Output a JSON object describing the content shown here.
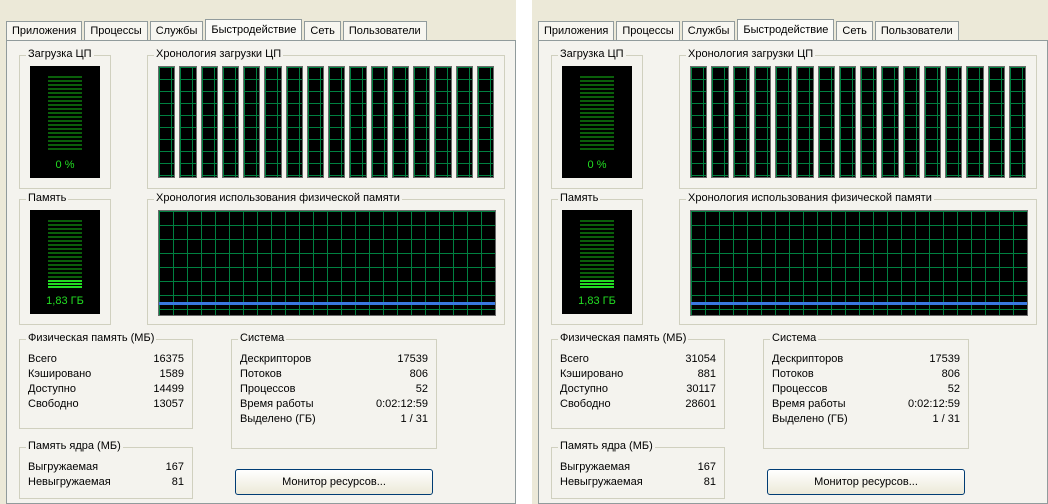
{
  "panels": [
    {
      "tabs": [
        "Приложения",
        "Процессы",
        "Службы",
        "Быстродействие",
        "Сеть",
        "Пользователи"
      ],
      "active_tab_index": 3,
      "cpu": {
        "label": "Загрузка ЦП",
        "value": "0 %",
        "usage_fraction": 0.0
      },
      "cpu_history": {
        "label": "Хронология загрузки ЦП",
        "core_count": 16
      },
      "memory": {
        "label": "Память",
        "value": "1,83 ГБ",
        "usage_fraction": 0.11
      },
      "memory_history": {
        "label": "Хронология использования физической памяти"
      },
      "physical_memory": {
        "label": "Физическая память (МБ)",
        "rows": [
          {
            "label": "Всего",
            "value": "16375"
          },
          {
            "label": "Кэшировано",
            "value": "1589"
          },
          {
            "label": "Доступно",
            "value": "14499"
          },
          {
            "label": "Свободно",
            "value": "13057"
          }
        ]
      },
      "kernel_memory": {
        "label": "Память ядра (МБ)",
        "rows": [
          {
            "label": "Выгружаемая",
            "value": "167"
          },
          {
            "label": "Невыгружаемая",
            "value": "81"
          }
        ]
      },
      "system": {
        "label": "Система",
        "rows": [
          {
            "label": "Дескрипторов",
            "value": "17539"
          },
          {
            "label": "Потоков",
            "value": "806"
          },
          {
            "label": "Процессов",
            "value": "52"
          },
          {
            "label": "Время работы",
            "value": "0:02:12:59"
          },
          {
            "label": "Выделено (ГБ)",
            "value": "1 / 31"
          }
        ]
      },
      "resource_monitor_button": "Монитор ресурсов..."
    },
    {
      "tabs": [
        "Приложения",
        "Процессы",
        "Службы",
        "Быстродействие",
        "Сеть",
        "Пользователи"
      ],
      "active_tab_index": 3,
      "cpu": {
        "label": "Загрузка ЦП",
        "value": "0 %",
        "usage_fraction": 0.0
      },
      "cpu_history": {
        "label": "Хронология загрузки ЦП",
        "core_count": 16
      },
      "memory": {
        "label": "Память",
        "value": "1,83 ГБ",
        "usage_fraction": 0.11
      },
      "memory_history": {
        "label": "Хронология использования физической памяти"
      },
      "physical_memory": {
        "label": "Физическая память (МБ)",
        "rows": [
          {
            "label": "Всего",
            "value": "31054"
          },
          {
            "label": "Кэшировано",
            "value": "881"
          },
          {
            "label": "Доступно",
            "value": "30117"
          },
          {
            "label": "Свободно",
            "value": "28601"
          }
        ]
      },
      "kernel_memory": {
        "label": "Память ядра (МБ)",
        "rows": [
          {
            "label": "Выгружаемая",
            "value": "167"
          },
          {
            "label": "Невыгружаемая",
            "value": "81"
          }
        ]
      },
      "system": {
        "label": "Система",
        "rows": [
          {
            "label": "Дескрипторов",
            "value": "17539"
          },
          {
            "label": "Потоков",
            "value": "806"
          },
          {
            "label": "Процессов",
            "value": "52"
          },
          {
            "label": "Время работы",
            "value": "0:02:12:59"
          },
          {
            "label": "Выделено (ГБ)",
            "value": "1 / 31"
          }
        ]
      },
      "resource_monitor_button": "Монитор ресурсов..."
    }
  ]
}
